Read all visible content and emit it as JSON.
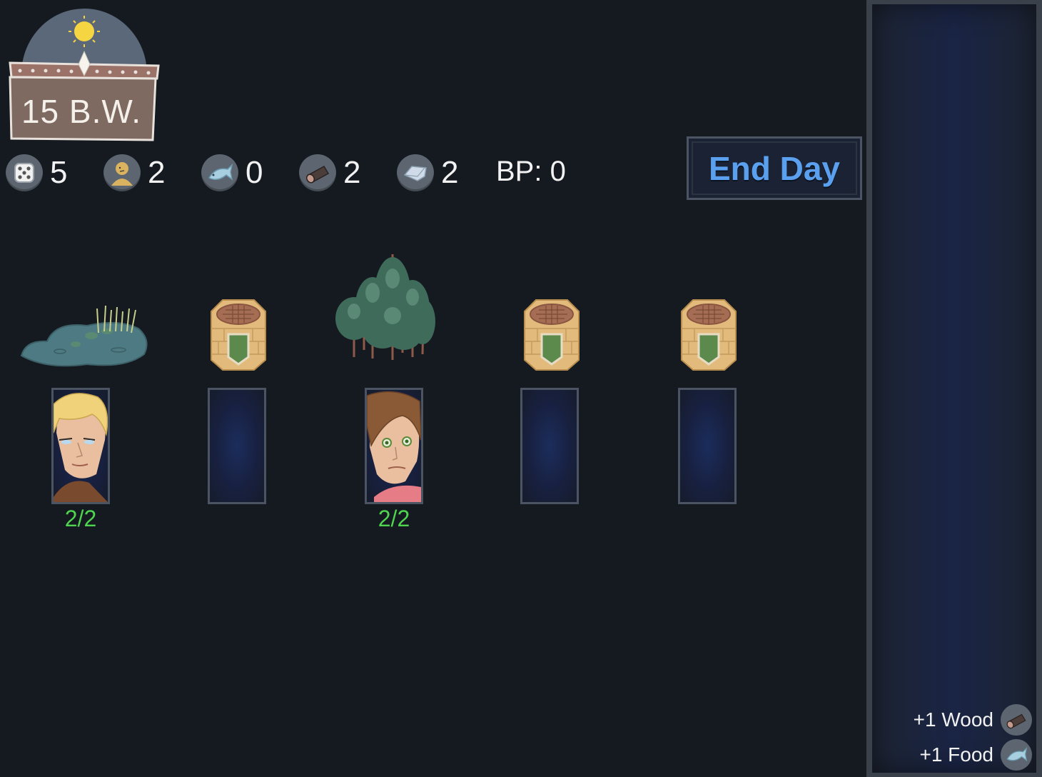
{
  "day": {
    "label": "15 B.W."
  },
  "resources": [
    {
      "name": "dice",
      "icon": "dice-icon",
      "value": "5"
    },
    {
      "name": "villagers",
      "icon": "villager-icon",
      "value": "2"
    },
    {
      "name": "food",
      "icon": "fish-icon",
      "value": "0"
    },
    {
      "name": "wood",
      "icon": "log-icon",
      "value": "2"
    },
    {
      "name": "stone",
      "icon": "stone-icon",
      "value": "2"
    }
  ],
  "bp": {
    "label": "BP: 0"
  },
  "end_day": {
    "label": "End Day"
  },
  "tiles": [
    {
      "kind": "pond",
      "slot": "occupied",
      "worker": "blonde-villager",
      "count": "2/2"
    },
    {
      "kind": "well",
      "slot": "empty",
      "count": ""
    },
    {
      "kind": "forest",
      "slot": "occupied",
      "worker": "brown-haired-villager",
      "count": "2/2"
    },
    {
      "kind": "well",
      "slot": "empty",
      "count": ""
    },
    {
      "kind": "well",
      "slot": "empty",
      "count": ""
    }
  ],
  "log": [
    {
      "text": "+1 Wood",
      "icon": "log-icon"
    },
    {
      "text": "+1 Food",
      "icon": "fish-icon"
    }
  ],
  "colors": {
    "background": "#151a21",
    "accent": "#5aa0ee",
    "count": "#4fd44f",
    "panel": "#3a414b"
  }
}
